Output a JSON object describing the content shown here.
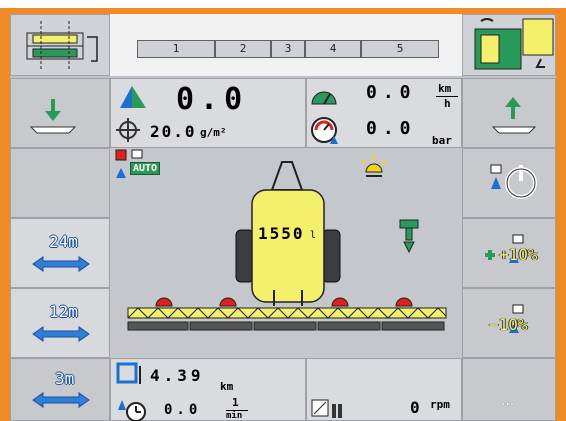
{
  "sections": {
    "labels": [
      "1",
      "2",
      "3",
      "4",
      "5"
    ]
  },
  "left_buttons": {
    "width_24": "24m",
    "width_12": "12m",
    "width_3": "3m"
  },
  "top_readout": {
    "speed_value": "0.0",
    "speed_unit_top": "km",
    "speed_unit_bottom": "h",
    "pressure_value": "0.0",
    "pressure_unit": "bar",
    "rate_value": "20.0",
    "rate_unit": "g/m²",
    "main_value": "0.0"
  },
  "mode": {
    "auto_label": "AUTO"
  },
  "tank": {
    "level": "1550",
    "unit": "l"
  },
  "right_buttons": {
    "rate_plus": "+10%",
    "rate_minus": "−10%",
    "more": "..."
  },
  "bottom_readout": {
    "distance_value": "4.39",
    "distance_unit": "km",
    "time_value": "0.0",
    "time_unit_top": "1",
    "time_unit_bottom": "min",
    "rpm_value": "0",
    "rpm_unit": "rpm"
  },
  "colors": {
    "frame": "#f08a24",
    "tank": "#f4f06b",
    "accent_blue": "#1a6fd0",
    "alarm_red": "#e02020"
  }
}
